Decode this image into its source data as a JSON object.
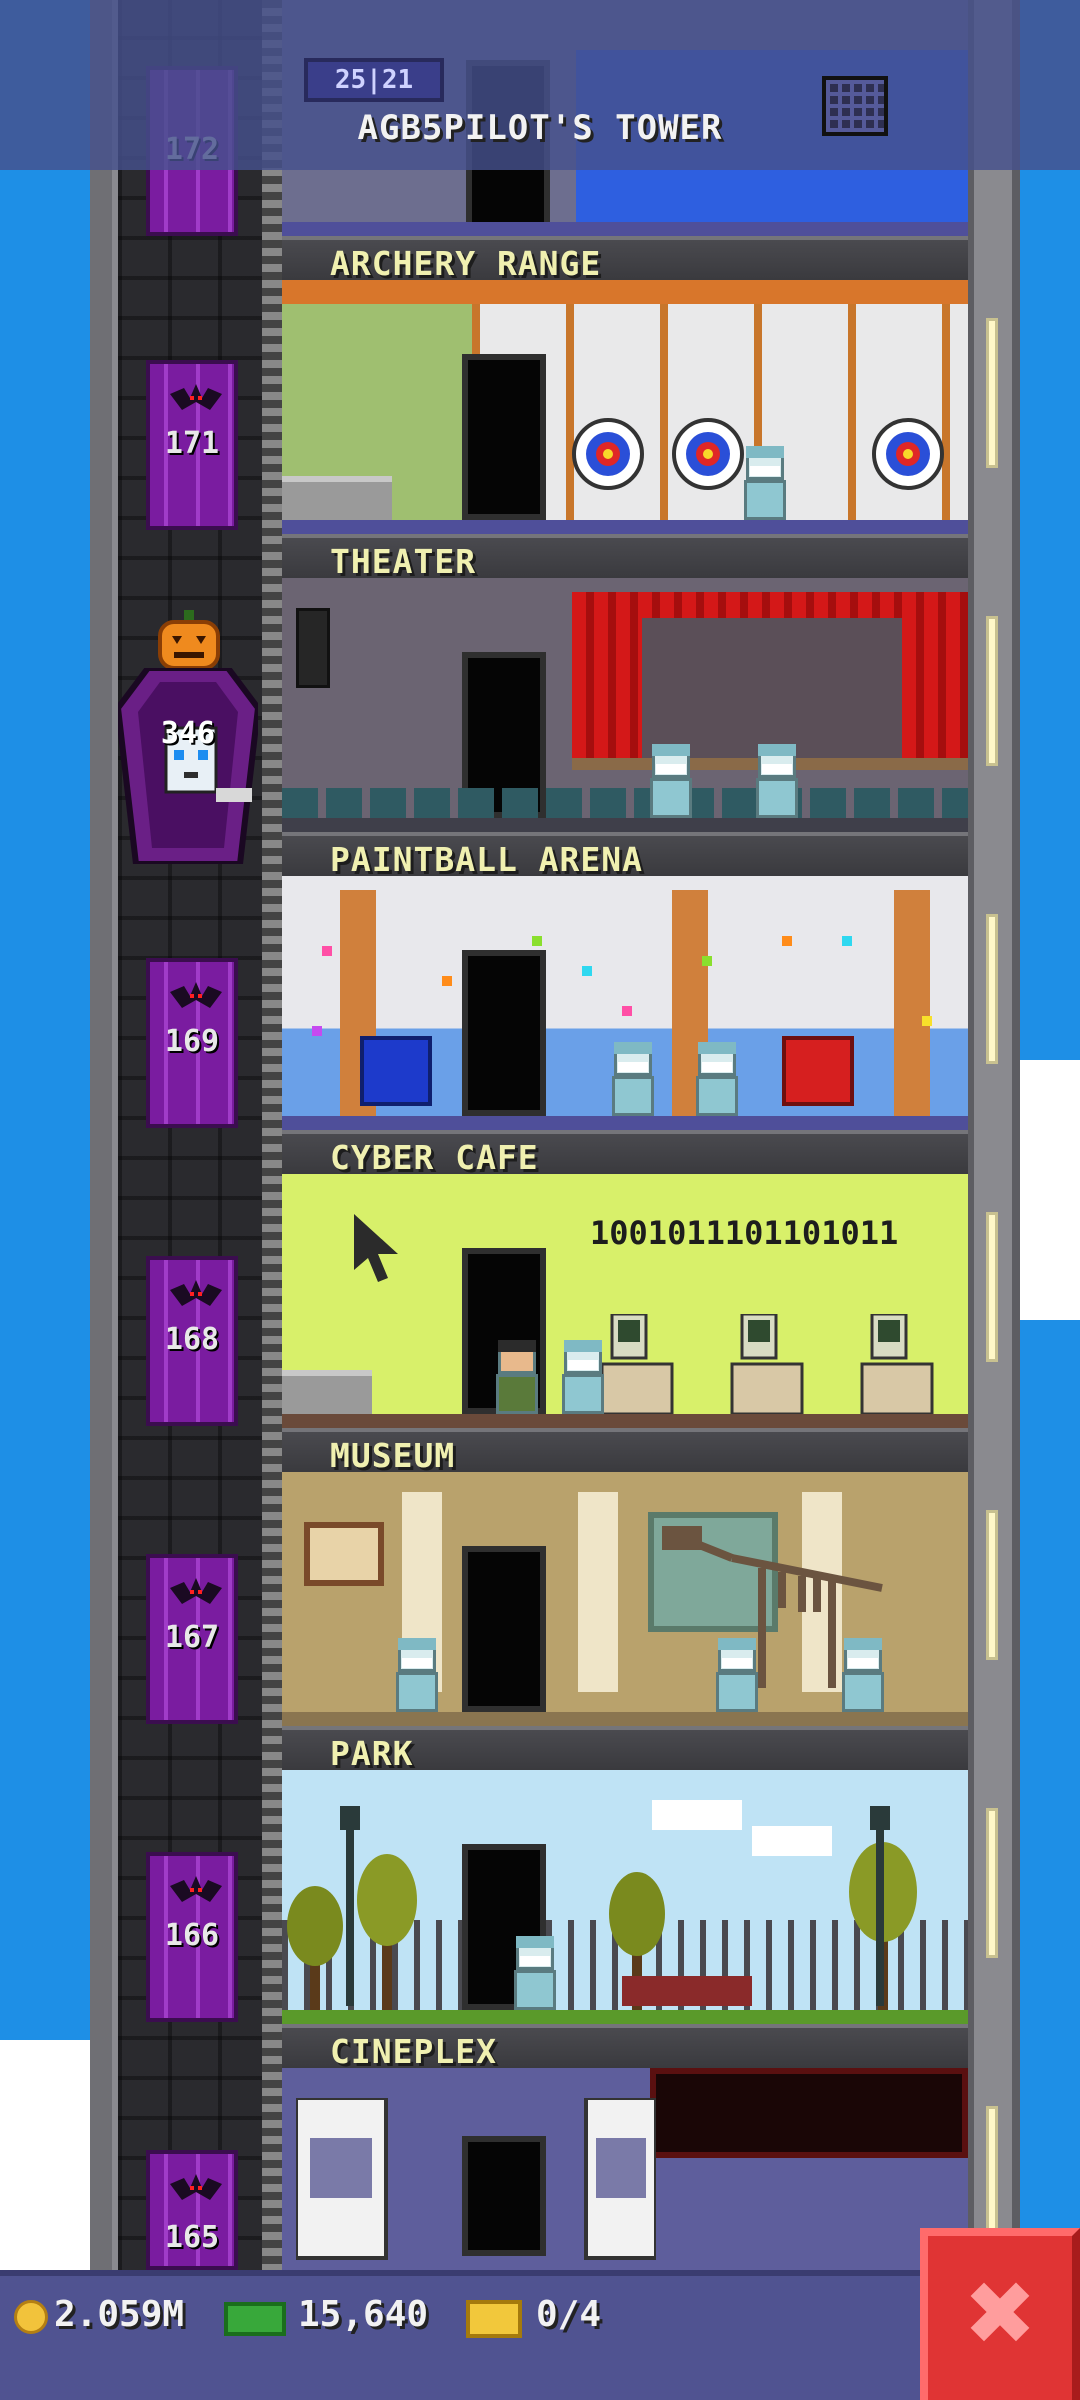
{
  "tower": {
    "title": "AGB5PILOT'S TOWER",
    "mini_display": "25|21"
  },
  "elevator": {
    "passenger_count": "346",
    "floor_numbers": [
      "172",
      "171",
      "169",
      "168",
      "167",
      "166",
      "165"
    ]
  },
  "floors": [
    {
      "label": "ARCHERY RANGE",
      "icon": "target-icon"
    },
    {
      "label": "THEATER",
      "icon": "stage-icon"
    },
    {
      "label": "PAINTBALL ARENA",
      "icon": "paint-splat-icon"
    },
    {
      "label": "CYBER CAFE",
      "icon": "computer-icon",
      "display_text": "1001011101101011"
    },
    {
      "label": "MUSEUM",
      "icon": "dinosaur-icon"
    },
    {
      "label": "PARK",
      "icon": "tree-icon"
    },
    {
      "label": "CINEPLEX",
      "icon": "movie-icon"
    }
  ],
  "hud": {
    "coins": "2.059M",
    "bux": "15,640",
    "tickets": "0/4"
  },
  "colors": {
    "sky": "#1e8fe6",
    "elevator_purple": "#7a1ca0",
    "label_text": "#f0f0b0",
    "close_red": "#e03434"
  }
}
